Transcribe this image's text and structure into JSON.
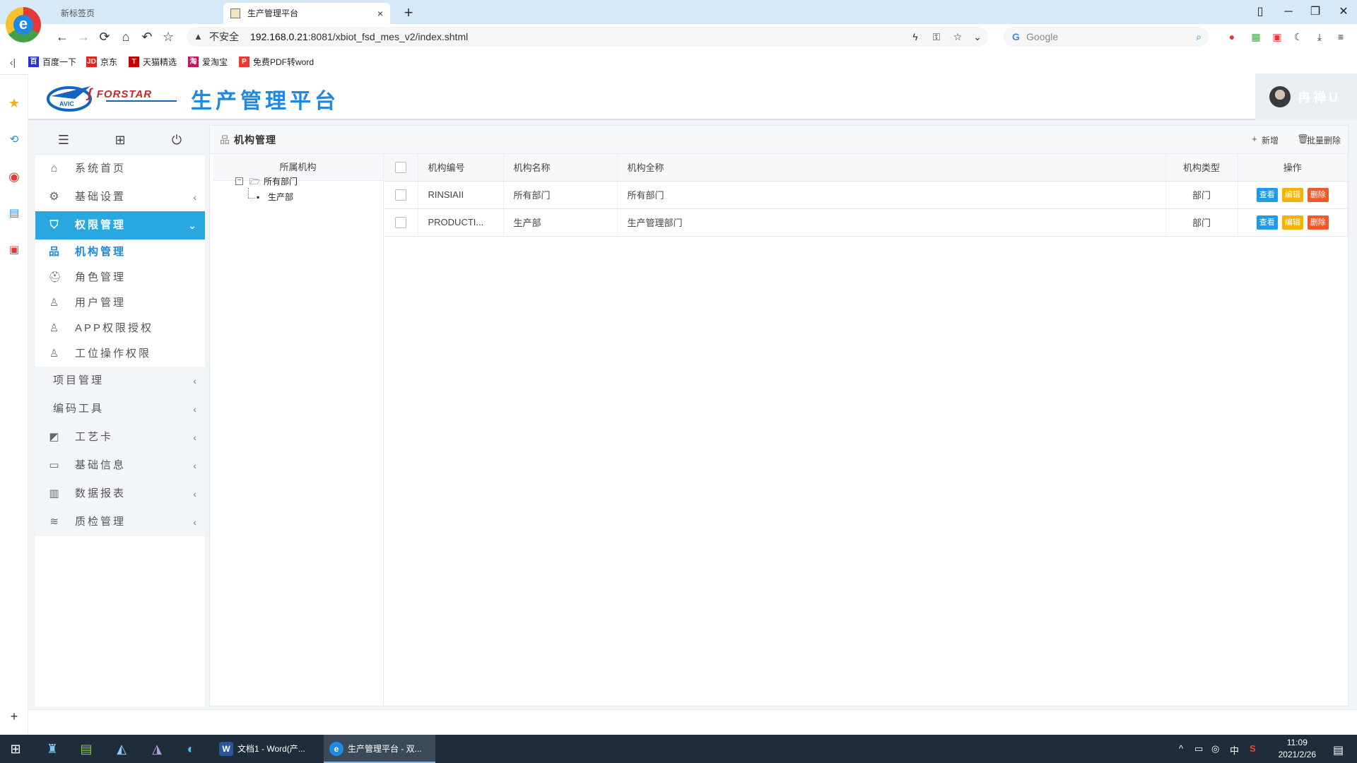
{
  "browser": {
    "tabs": [
      {
        "label": "新标签页"
      },
      {
        "label": "生产管理平台",
        "close": "×"
      }
    ],
    "new_tab": "+",
    "window_controls": {
      "pin": "▯",
      "minimize": "─",
      "restore": "❐",
      "close": "✕"
    },
    "address": {
      "warning_icon": "warning-icon",
      "insecure_label": "不安全",
      "host": "192.168.0.21",
      "path": ":8081/xbiot_fsd_mes_v2/index.shtml"
    },
    "search": {
      "engine_icon": "G",
      "placeholder": "Google"
    },
    "bookmarks": [
      {
        "label": "百度一下",
        "color": "#2932e1",
        "glyph": "百"
      },
      {
        "label": "京东",
        "color": "#e1251b",
        "glyph": "JD"
      },
      {
        "label": "天猫精选",
        "color": "#c40000",
        "glyph": "T"
      },
      {
        "label": "爱淘宝",
        "color": "#c2185b",
        "glyph": "淘"
      },
      {
        "label": "免费PDF转word",
        "color": "#e53935",
        "glyph": "P"
      }
    ]
  },
  "app": {
    "title": "生产管理平台",
    "logo": {
      "avic": "AVIC",
      "forstar": "FORSTAR"
    },
    "user": {
      "name": "冉禅U"
    }
  },
  "sidebar": {
    "tools": [
      "menu-toggle-icon",
      "book-icon",
      "power-icon"
    ],
    "menu": [
      {
        "label": "系统首页",
        "icon": "home-icon"
      },
      {
        "label": "基础设置",
        "icon": "gear-icon",
        "arrow": "‹"
      },
      {
        "label": "权限管理",
        "icon": "shield-icon",
        "arrow": "⌄",
        "active": true
      }
    ],
    "submenu": [
      {
        "label": "机构管理",
        "icon": "org-icon",
        "current": true
      },
      {
        "label": "角色管理",
        "icon": "group-icon"
      },
      {
        "label": "用户管理",
        "icon": "user-icon"
      },
      {
        "label": "APP权限授权",
        "icon": "user-icon"
      },
      {
        "label": "工位操作权限",
        "icon": "user-icon"
      }
    ],
    "groups": [
      {
        "label": "项目管理",
        "arrow": "‹"
      },
      {
        "label": "编码工具",
        "arrow": "‹"
      },
      {
        "label": "工艺卡",
        "icon": "card-icon",
        "arrow": "‹"
      },
      {
        "label": "基础信息",
        "icon": "monitor-icon",
        "arrow": "‹"
      },
      {
        "label": "数据报表",
        "icon": "table-icon",
        "arrow": "‹"
      },
      {
        "label": "质检管理",
        "icon": "layers-icon",
        "arrow": "‹"
      }
    ]
  },
  "content": {
    "breadcrumb": "机构管理",
    "actions": {
      "add": "新增",
      "batch_delete": "批量删除"
    },
    "tree": {
      "header": "所属机构",
      "root": "所有部门",
      "child": "生产部",
      "toggle": "−"
    },
    "table": {
      "columns": [
        "机构编号",
        "机构名称",
        "机构全称",
        "机构类型",
        "操作"
      ],
      "rows": [
        {
          "code": "RINSIAII",
          "name": "所有部门",
          "full_name": "所有部门",
          "type": "部门"
        },
        {
          "code": "PRODUCTI...",
          "name": "生产部",
          "full_name": "生产管理部门",
          "type": "部门"
        }
      ],
      "row_actions": {
        "view": "查看",
        "edit": "编辑",
        "delete": "删除"
      }
    }
  },
  "taskbar": {
    "apps": [
      {
        "label": "文档1 - Word(产...",
        "glyph": "W",
        "color": "#2b579a"
      },
      {
        "label": "生产管理平台 - 双...",
        "glyph": "e",
        "color": "#1e88e5",
        "active": true
      }
    ],
    "tray": {
      "ime": "中",
      "caret": "^"
    },
    "time": "11:09",
    "date": "2021/2/26"
  },
  "colors": {
    "accent": "#29a8e0",
    "title_blue": "#1e88e5",
    "view": "#1e9be9",
    "edit": "#f4b400",
    "delete": "#f05a28"
  }
}
